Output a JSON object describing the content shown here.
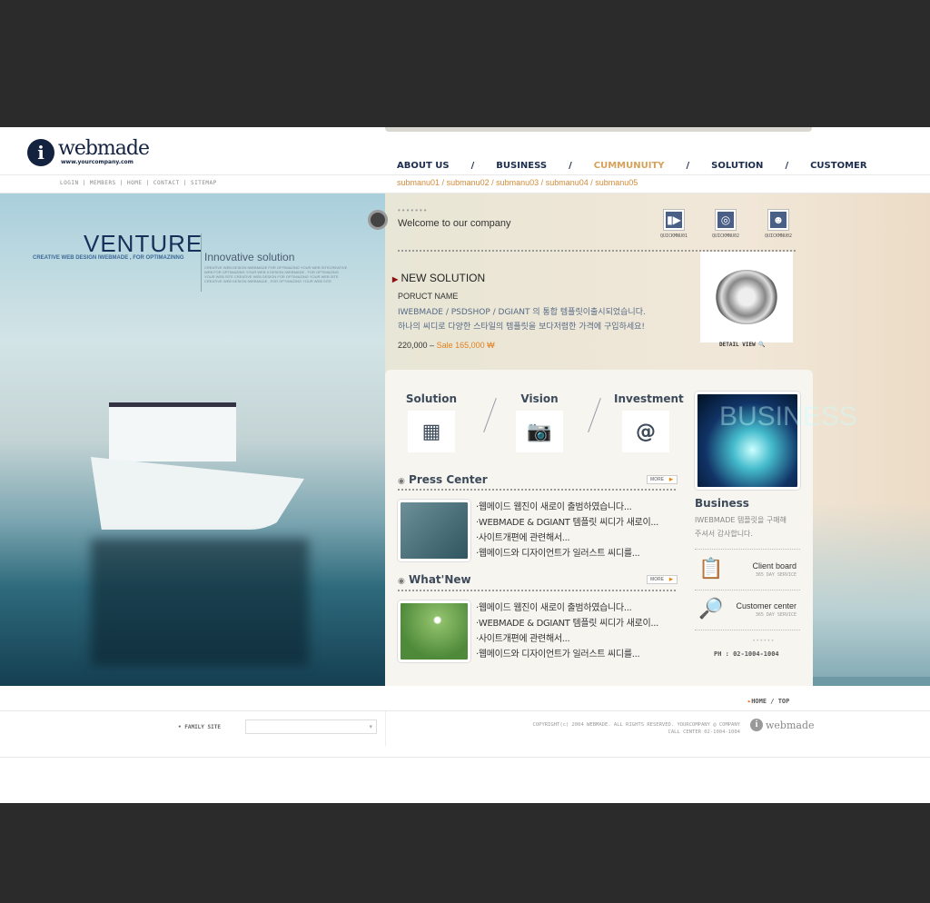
{
  "header": {
    "logo_text": "webmade",
    "logo_url": "www.yourcompany.com",
    "utility_links": [
      "LOGIN",
      "MEMBERS",
      "HOME",
      "CONTACT",
      "SITEMAP"
    ],
    "nav": [
      {
        "label": "ABOUT US"
      },
      {
        "label": "BUSINESS"
      },
      {
        "label": "CUMMUNUITY",
        "active": true
      },
      {
        "label": "SOLUTION"
      },
      {
        "label": "CUSTOMER"
      }
    ],
    "nav_separator": "/",
    "submenu": [
      "submanu01",
      "submanu02",
      "submanu03",
      "submanu04",
      "submanu05"
    ]
  },
  "hero": {
    "title": "VENTURE",
    "tagline": "CREATIVE WEB DESIGN IWEBMADE , FOR OPTIMAZINNG",
    "subtitle": "Innovative solution",
    "body": "CREATIVE WEB DESIGN IWEBMADE FOR OPTIMAZING YOUR WEB SITECREATIVE WEB FOR OPTIMAZING YOUR WEB II DESIGN IWEBMADE , FOR OPTIMAZING YOUR WEB SITE CREATIVE WEB DESIGN FOR OPTIMAZING YOUR WEB SITE CREATIVE WEB DESIGN IWEBMADE , FOR OPTIMAZING YOUR WEB SITE"
  },
  "welcome": {
    "text": "Welcome to our company",
    "quickmenu": [
      "QUICKMNU01",
      "QUICKMNU02",
      "QUICKMNU02"
    ]
  },
  "new_solution": {
    "heading": "NEW SOLUTION",
    "product_name": "PORUCT  NAME",
    "line1": "IWEBMADE / PSDSHOP / DGIANT 의 통합 템플릿이출시되었습니다.",
    "line2": "하나의 씨디로 다양한 스타일의 템플릿을 보다저렴한 가격에 구입하세요!",
    "price": "220,000 –",
    "sale": "Sale 165,000 ₩",
    "detail": "DETAIL VIEW"
  },
  "categories": [
    "Solution",
    "Vision",
    "Investment"
  ],
  "press": {
    "title": "Press Center",
    "more": "MORE",
    "items": [
      "·웹메이드 웹진이 새로이 출범하였습니다...",
      "·WEBMADE & DGIANT 템플릿 씨디가 새로이...",
      "·사이트개편에 관련해서...",
      "·웹메이드와 디자이언트가 일러스트 씨디를..."
    ]
  },
  "whatsnew": {
    "title": "What'New",
    "more": "MORE",
    "items": [
      "·웹메이드 웹진이 새로이 출범하였습니다...",
      "·WEBMADE & DGIANT 템플릿 씨디가 새로이...",
      "·사이트개편에 관련해서...",
      "·웹메이드와 디자이언트가 일러스트 씨디를..."
    ]
  },
  "business": {
    "title": "Business",
    "desc1": "IWEBMADE 템플릿을 구매해",
    "desc2": "주셔서 감사합니다.",
    "image_text": "BUSINESS"
  },
  "services": [
    {
      "title": "Client board",
      "sub": "365 DAY SERVICE"
    },
    {
      "title": "Customer center",
      "sub": "365 DAY SERVICE"
    }
  ],
  "phone": "PH : 02-1004-1004",
  "footer": {
    "home_top": "HOME / TOP",
    "family_site": "FAMILY SITE",
    "copyright": "COPYRIGHT(c) 2004 WEBMADE. ALL RIGHTS RESERVED. YOURCOMPANY @ COMPANY",
    "call_center": "CALL CENTER 02-1004-1004",
    "logo_text": "webmade"
  },
  "colors": {
    "navy": "#13223f",
    "accent_orange": "#d28a3a",
    "sale": "#e08020",
    "background": "#2b2b2b"
  }
}
